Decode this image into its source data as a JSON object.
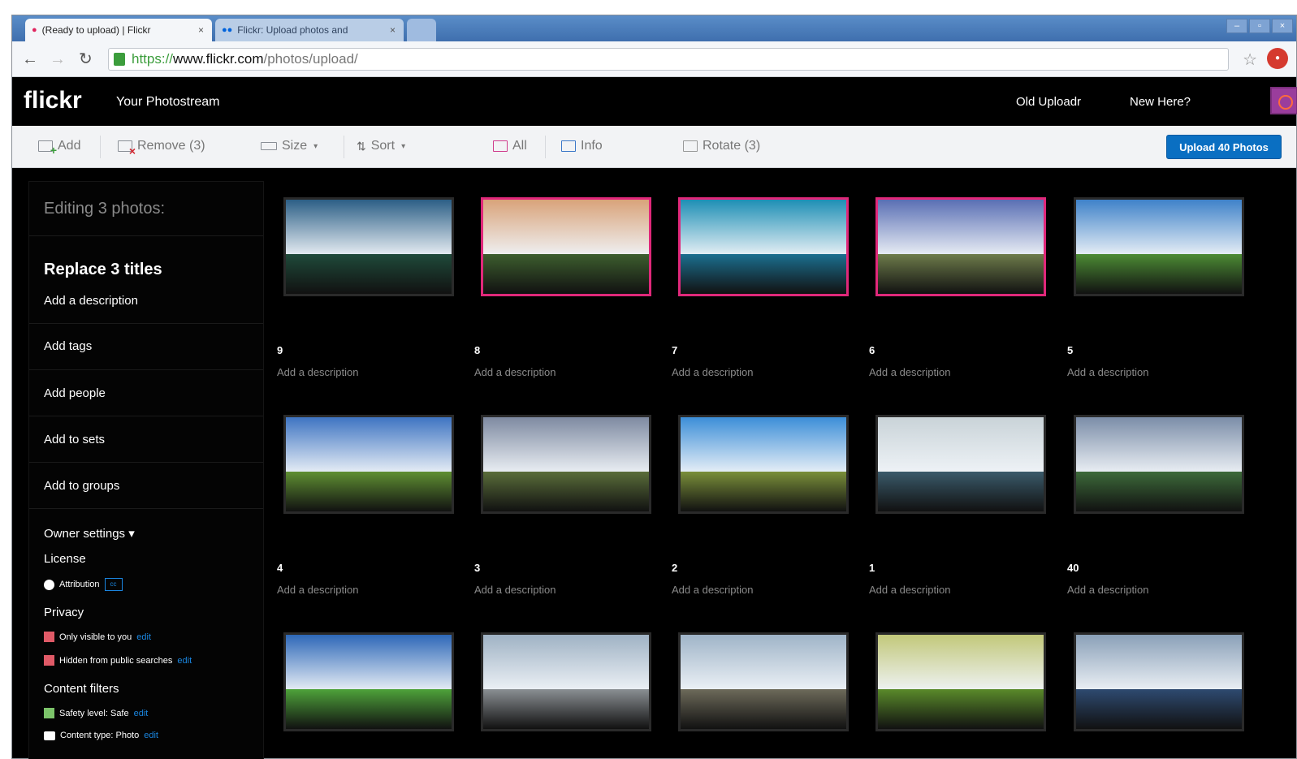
{
  "browser": {
    "tabs": [
      {
        "title": "(Ready to upload) | Flickr",
        "close": "×",
        "active": true
      },
      {
        "title": "Flickr: Upload photos and",
        "close": "×",
        "active": false
      }
    ],
    "window_controls": [
      "–",
      "▫",
      "×"
    ],
    "url": {
      "scheme": "https://",
      "host": "www.flickr.com",
      "path": "/photos/upload/"
    },
    "icons": {
      "back": "back-arrow-icon",
      "forward": "forward-arrow-icon",
      "reload": "reload-icon",
      "star": "star-icon",
      "extension": "extension-icon"
    }
  },
  "header": {
    "logo": "flickr",
    "photostream": "Your Photostream",
    "old_uploadr": "Old Uploadr",
    "new_here": "New Here?"
  },
  "toolbar": {
    "add": "Add",
    "remove": "Remove (3)",
    "size": "Size",
    "sort": "Sort",
    "all": "All",
    "info": "Info",
    "rotate": "Rotate (3)",
    "upload": "Upload 40 Photos"
  },
  "sidebar": {
    "editing": "Editing 3 photos:",
    "replace_titles": "Replace 3 titles",
    "add_description": "Add a description",
    "add_tags": "Add tags",
    "add_people": "Add people",
    "add_sets": "Add to sets",
    "add_groups": "Add to groups",
    "owner_settings": "Owner settings",
    "license_label": "License",
    "license_value": "Attribution",
    "license_badge": "cc",
    "privacy_label": "Privacy",
    "privacy_1": "Only visible to you",
    "privacy_2": "Hidden from public searches",
    "content_filters_label": "Content filters",
    "safety": "Safety level: Safe",
    "content_type": "Content type: Photo",
    "edit": "edit"
  },
  "photos": [
    {
      "num": "9",
      "desc": "Add a description",
      "selected": false,
      "sky": "#2c5f86",
      "ground": "#1f4a3a"
    },
    {
      "num": "8",
      "desc": "Add a description",
      "selected": true,
      "sky": "#d9a37a",
      "ground": "#3d5e2e"
    },
    {
      "num": "7",
      "desc": "Add a description",
      "selected": true,
      "sky": "#1e8fb5",
      "ground": "#1b6f8f"
    },
    {
      "num": "6",
      "desc": "Add a description",
      "selected": true,
      "sky": "#5a6fb4",
      "ground": "#6d7b4a"
    },
    {
      "num": "5",
      "desc": "Add a description",
      "selected": false,
      "sky": "#3f82c9",
      "ground": "#4c8b34"
    },
    {
      "num": "4",
      "desc": "Add a description",
      "selected": false,
      "sky": "#3e74c2",
      "ground": "#5f8f32"
    },
    {
      "num": "3",
      "desc": "Add a description",
      "selected": false,
      "sky": "#7e8aa1",
      "ground": "#5a6d3a"
    },
    {
      "num": "2",
      "desc": "Add a description",
      "selected": false,
      "sky": "#3c8ed8",
      "ground": "#7a8f3a"
    },
    {
      "num": "1",
      "desc": "Add a description",
      "selected": false,
      "sky": "#c9d3d8",
      "ground": "#3a5a6a"
    },
    {
      "num": "40",
      "desc": "Add a description",
      "selected": false,
      "sky": "#7b8da8",
      "ground": "#3d6a3a"
    },
    {
      "num": "",
      "desc": "",
      "selected": false,
      "sky": "#2e68b8",
      "ground": "#4ea23a"
    },
    {
      "num": "",
      "desc": "",
      "selected": false,
      "sky": "#9fb2c4",
      "ground": "#8a8f93"
    },
    {
      "num": "",
      "desc": "",
      "selected": false,
      "sky": "#9fb4c8",
      "ground": "#6d6a5a"
    },
    {
      "num": "",
      "desc": "",
      "selected": false,
      "sky": "#c2c87a",
      "ground": "#5a8a2a"
    },
    {
      "num": "",
      "desc": "",
      "selected": false,
      "sky": "#8aa0b8",
      "ground": "#2e4a70"
    }
  ]
}
